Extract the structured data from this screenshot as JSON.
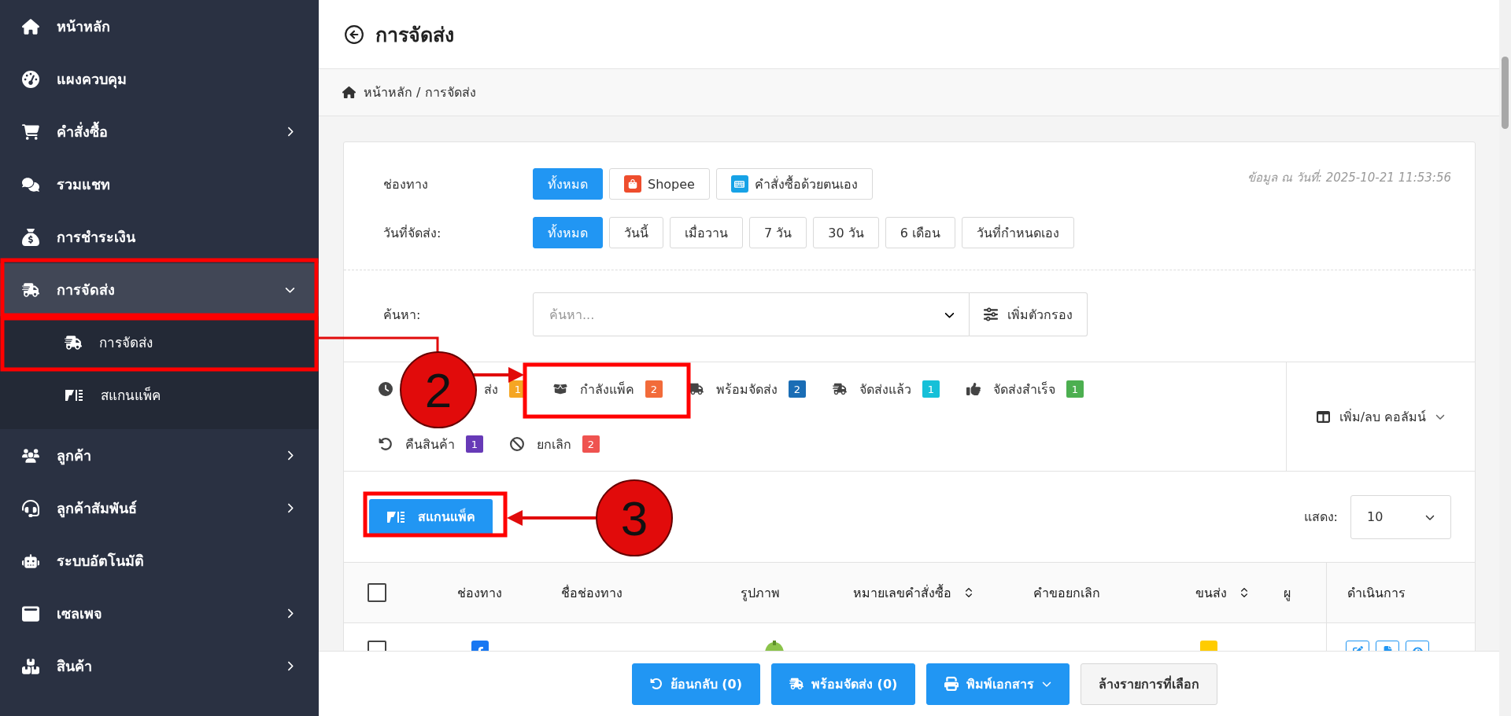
{
  "sidebar": {
    "items": [
      {
        "label": "หน้าหลัก",
        "selected": false
      },
      {
        "label": "แผงควบคุม",
        "selected": false
      },
      {
        "label": "คำสั่งซื้อ",
        "selected": false,
        "expanded": false
      },
      {
        "label": "รวมแชท",
        "selected": false
      },
      {
        "label": "การชำระเงิน",
        "selected": false
      },
      {
        "label": "การจัดส่ง",
        "selected": true,
        "expanded": true,
        "children": [
          {
            "label": "การจัดส่ง"
          },
          {
            "label": "สแกนแพ็ค"
          }
        ]
      },
      {
        "label": "ลูกค้า",
        "selected": false,
        "expanded": false
      },
      {
        "label": "ลูกค้าสัมพันธ์",
        "selected": false,
        "expanded": false
      },
      {
        "label": "ระบบอัตโนมัติ",
        "selected": false
      },
      {
        "label": "เซลเพจ",
        "selected": false,
        "expanded": false
      },
      {
        "label": "สินค้า",
        "selected": false,
        "expanded": false
      }
    ]
  },
  "header": {
    "title": "การจัดส่ง",
    "breadcrumb": "หน้าหลัก / การจัดส่ง"
  },
  "filters": {
    "channel": {
      "label": "ช่องทาง",
      "options": [
        {
          "label": "ทั้งหมด",
          "kind": "all",
          "selected": true
        },
        {
          "label": "Shopee",
          "kind": "shopee",
          "selected": false
        },
        {
          "label": "คำสั่งซื้อด้วยตนเอง",
          "kind": "manual",
          "selected": false
        }
      ]
    },
    "date": {
      "label": "วันที่จัดส่ง:",
      "options": [
        {
          "label": "ทั้งหมด",
          "selected": true
        },
        {
          "label": "วันนี้",
          "selected": false
        },
        {
          "label": "เมื่อวาน",
          "selected": false
        },
        {
          "label": "7 วัน",
          "selected": false
        },
        {
          "label": "30 วัน",
          "selected": false
        },
        {
          "label": "6 เดือน",
          "selected": false
        },
        {
          "label": "วันที่กำหนดเอง",
          "selected": false
        }
      ]
    },
    "timestamp": "ข้อมูล ณ วันที่: 2025-10-21 11:53:56",
    "search": {
      "label": "ค้นหา:",
      "placeholder": "ค้นหา..."
    },
    "filter_button": "เพิ่มตัวกรอง"
  },
  "status_tabs": [
    {
      "label": "ส่ง",
      "count": "1",
      "color": "#f5a623"
    },
    {
      "label": "กำลังแพ็ค",
      "count": "2",
      "color": "#f26b3a"
    },
    {
      "label": "พร้อมจัดส่ง",
      "count": "2",
      "color": "#1a6db5"
    },
    {
      "label": "จัดส่งแล้ว",
      "count": "1",
      "color": "#16c0d8"
    },
    {
      "label": "จัดส่งสำเร็จ",
      "count": "1",
      "color": "#4caf50"
    },
    {
      "label": "คืนสินค้า",
      "count": "1",
      "color": "#673ab7"
    },
    {
      "label": "ยกเลิก",
      "count": "2",
      "color": "#ef5350"
    }
  ],
  "column_toggle": "เพิ่ม/ลบ คอลัมน์",
  "scan_button": "สแกนแพ็ค",
  "page_size": {
    "label": "แสดง:",
    "value": "10"
  },
  "table": {
    "select_all_checked": false,
    "columns": [
      {
        "label": "ช่องทาง",
        "sortable": false
      },
      {
        "label": "ชื่อช่องทาง",
        "sortable": false
      },
      {
        "label": "รูปภาพ",
        "sortable": false
      },
      {
        "label": "หมายเลขคำสั่งซื้อ",
        "sortable": true
      },
      {
        "label": "คำขอยกเลิก",
        "sortable": false
      },
      {
        "label": "ขนส่ง",
        "sortable": true
      },
      {
        "label": "ผู",
        "sortable": false
      },
      {
        "label": "ดำเนินการ",
        "sortable": false
      }
    ],
    "rows": [
      {
        "checked": false
      }
    ]
  },
  "bottom_bar": [
    {
      "label": "ย้อนกลับ (0)",
      "kind": "undo"
    },
    {
      "label": "พร้อมจัดส่ง (0)",
      "kind": "ship"
    },
    {
      "label": "พิมพ์เอกสาร",
      "kind": "print"
    },
    {
      "label": "ล้างรายการที่เลือก",
      "kind": "clear"
    }
  ],
  "annotations": [
    {
      "label": "2"
    },
    {
      "label": "3"
    }
  ]
}
